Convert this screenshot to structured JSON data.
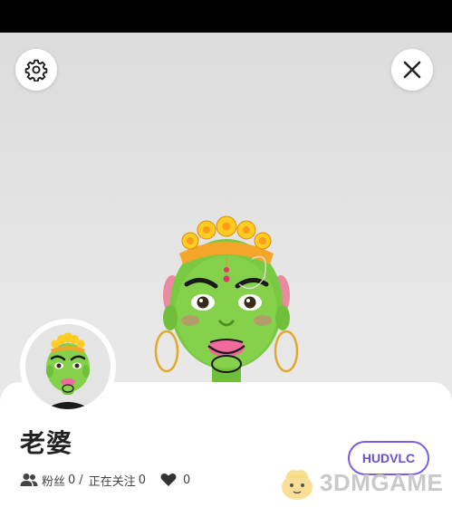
{
  "profile": {
    "name": "老婆",
    "user_id": "HUDVLC",
    "stats": {
      "followers_label": "粉丝",
      "followers_count": "0",
      "separator": "/",
      "following_label": "正在关注",
      "following_count": "0",
      "likes_count": "0"
    }
  },
  "icons": {
    "settings": "gear-icon",
    "close": "close-icon",
    "followers": "people-icon",
    "likes": "heart-icon"
  },
  "colors": {
    "accent": "#7b5ce6",
    "background": "#e6e6e6",
    "sheet": "#ffffff"
  },
  "watermark": {
    "text": "3DMGAME"
  }
}
